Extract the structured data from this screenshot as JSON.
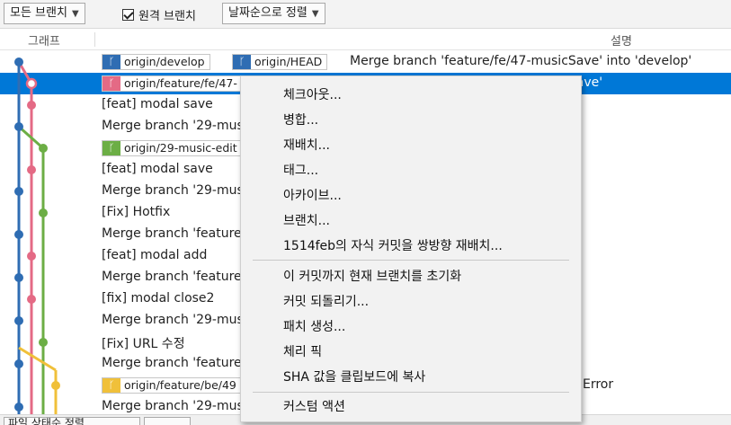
{
  "toolbar": {
    "branch_filter": "모든 브랜치",
    "remote_branches_label": "원격 브랜치",
    "sort_label": "날짜순으로 정렬"
  },
  "header": {
    "graph": "그래프",
    "description": "설명"
  },
  "rows": [
    {
      "tags": [
        {
          "label": "origin/develop",
          "color": "blue"
        },
        {
          "label": "origin/HEAD",
          "color": "blue"
        }
      ],
      "message": "Merge branch 'feature/fe/47-musicSave' into 'develop'"
    },
    {
      "tags": [
        {
          "label": "origin/feature/fe/47-",
          "color": "red"
        }
      ],
      "message": "Merge branch 'feature/fe/47-musicSave'"
    },
    {
      "tags": [],
      "message": "[feat] modal save"
    },
    {
      "tags": [],
      "message": "Merge branch '29-mus"
    },
    {
      "tags": [
        {
          "label": "origin/29-music-edit",
          "color": "green"
        }
      ],
      "message": ""
    },
    {
      "tags": [],
      "message": "[feat] modal save"
    },
    {
      "tags": [],
      "message": "Merge branch '29-mus"
    },
    {
      "tags": [],
      "message": "[Fix] Hotfix"
    },
    {
      "tags": [],
      "message": "Merge branch 'feature"
    },
    {
      "tags": [],
      "message": "[feat] modal add"
    },
    {
      "tags": [],
      "message": "Merge branch 'feature"
    },
    {
      "tags": [],
      "message": "[fix] modal close2"
    },
    {
      "tags": [],
      "message": "Merge branch '29-mus"
    },
    {
      "tags": [],
      "message": "[Fix] URL 수정"
    },
    {
      "tags": [],
      "message": "Merge branch 'feature"
    },
    {
      "tags": [
        {
          "label": "origin/feature/be/49",
          "color": "yellow"
        }
      ],
      "message": "Error"
    },
    {
      "tags": [],
      "message": "Merge branch '29-mus"
    }
  ],
  "context_menu": {
    "group1": [
      "체크아웃...",
      "병합...",
      "재배치...",
      "태그...",
      "아카이브...",
      "브랜치...",
      "1514feb의 자식 커밋을 쌍방향 재배치..."
    ],
    "group2": [
      "이 커밋까지 현재 브랜치를 초기화",
      "커밋 되돌리기...",
      "패치 생성...",
      "체리 픽",
      "SHA 값을 클립보드에 복사"
    ],
    "group3": [
      "커스텀 액션"
    ]
  },
  "statusbar": {
    "file_status_label": "파일 상태순 정렬"
  },
  "colors": {
    "blue": "#2f6db3",
    "red": "#e46a85",
    "green": "#6cae45",
    "yellow": "#f0c03a",
    "selection": "#0078d7"
  },
  "icons": {
    "branch": "git-branch-icon",
    "dropdown": "chevron-down-icon",
    "checkbox": "checkmark-icon"
  }
}
